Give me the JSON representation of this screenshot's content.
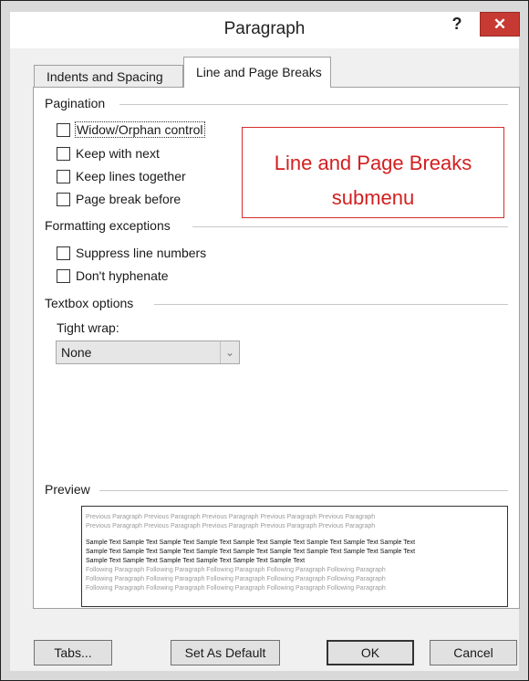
{
  "dialog": {
    "title": "Paragraph",
    "help_glyph": "?",
    "close_glyph": "✕"
  },
  "tabs": [
    {
      "label": "Indents and Spacing",
      "active": false
    },
    {
      "label": "Line and Page Breaks",
      "active": true
    }
  ],
  "pagination": {
    "heading": "Pagination",
    "options": [
      {
        "label": "Widow/Orphan control",
        "checked": false
      },
      {
        "label": "Keep with next",
        "checked": false
      },
      {
        "label": "Keep lines together",
        "checked": false
      },
      {
        "label": "Page break before",
        "checked": false
      }
    ]
  },
  "annotation": {
    "line1": "Line and Page Breaks",
    "line2": "submenu"
  },
  "formatting": {
    "heading": "Formatting exceptions",
    "options": [
      {
        "label": "Suppress line numbers",
        "checked": false
      },
      {
        "label": "Don't hyphenate",
        "checked": false
      }
    ]
  },
  "textbox": {
    "heading": "Textbox options",
    "tight_wrap_label": "Tight wrap:",
    "tight_wrap_value": "None"
  },
  "preview": {
    "heading": "Preview",
    "previous_lines": [
      "Previous Paragraph Previous Paragraph Previous Paragraph Previous Paragraph Previous Paragraph",
      "Previous Paragraph Previous Paragraph Previous Paragraph Previous Paragraph Previous Paragraph"
    ],
    "sample_lines": [
      "Sample Text Sample Text Sample Text Sample Text Sample Text Sample Text Sample Text Sample Text Sample Text",
      "Sample Text Sample Text Sample Text Sample Text Sample Text Sample Text Sample Text Sample Text Sample Text",
      "Sample Text Sample Text Sample Text Sample Text Sample Text Sample Text"
    ],
    "following_lines": [
      "Following Paragraph Following Paragraph Following Paragraph Following Paragraph Following Paragraph",
      "Following Paragraph Following Paragraph Following Paragraph Following Paragraph Following Paragraph",
      "Following Paragraph Following Paragraph Following Paragraph Following Paragraph Following Paragraph"
    ]
  },
  "buttons": {
    "tabs": "Tabs...",
    "set_default": "Set As Default",
    "ok": "OK",
    "cancel": "Cancel"
  },
  "colors": {
    "close_button": "#c73a33",
    "annotation": "#d21f1f"
  }
}
